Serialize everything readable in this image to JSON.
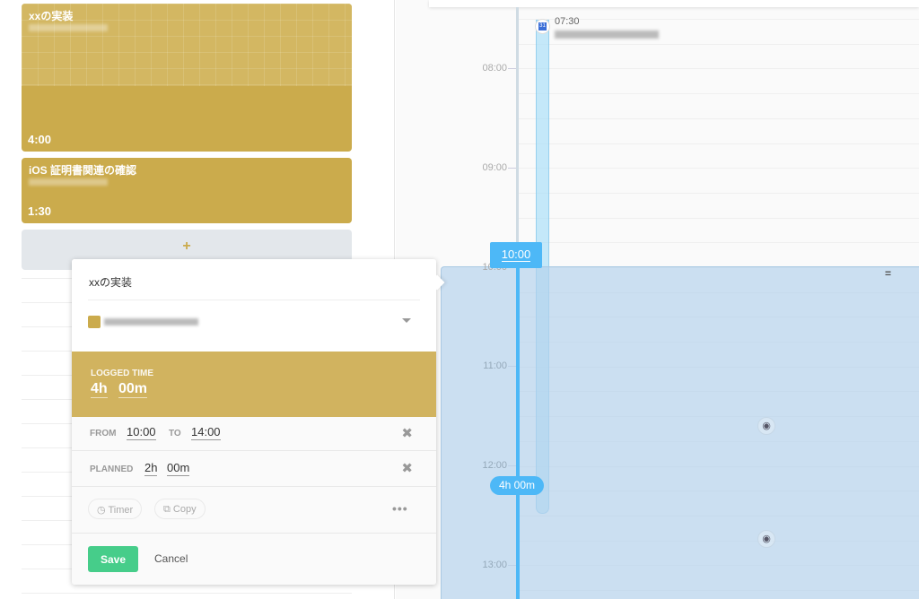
{
  "tasks": [
    {
      "title": "xxの実装",
      "duration": "4:00"
    },
    {
      "title": "iOS 証明書関連の確認",
      "duration": "1:30"
    }
  ],
  "add_label": "+",
  "timeline": {
    "hours": [
      "08:00",
      "09:00",
      "10:00",
      "11:00",
      "12:00",
      "13:00"
    ],
    "event_time": "07:30",
    "selection_start": "10:00",
    "selection_duration": "4h 00m",
    "handle": "="
  },
  "popover": {
    "title": "xxの実装",
    "logged_label": "LOGGED TIME",
    "logged_h": "4h",
    "logged_m": "00m",
    "from_label": "FROM",
    "from": "10:00",
    "to_label": "TO",
    "to": "14:00",
    "planned_label": "PLANNED",
    "planned_h": "2h",
    "planned_m": "00m",
    "timer": "Timer",
    "copy": "Copy",
    "more": "•••",
    "save": "Save",
    "cancel": "Cancel"
  },
  "colors": {
    "task": "#cbab4c",
    "selection": "#4db8f7",
    "save": "#46cd8a"
  }
}
